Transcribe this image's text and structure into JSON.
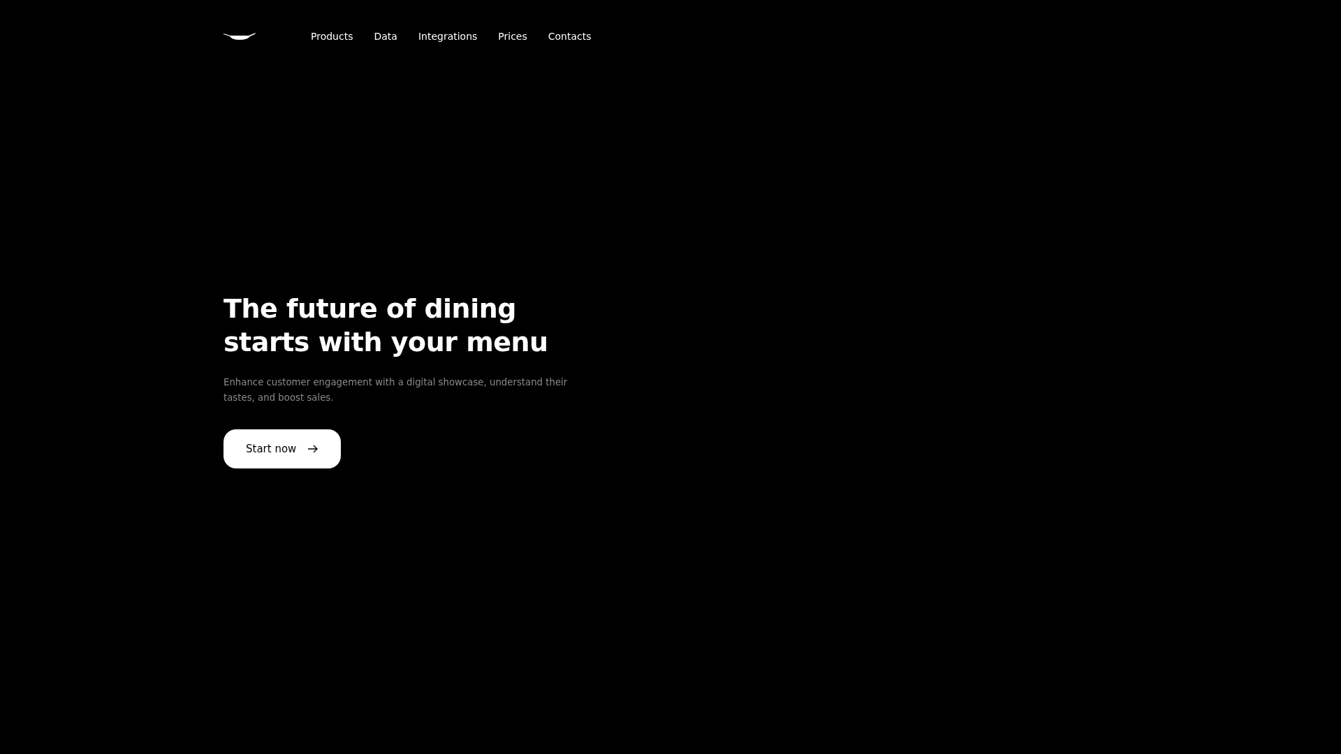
{
  "nav": {
    "items": [
      "Products",
      "Data",
      "Integrations",
      "Prices",
      "Contacts"
    ]
  },
  "hero": {
    "title": "The future of dining starts with your menu",
    "subtitle": "Enhance customer engagement with a digital showcase, understand their tastes, and boost sales.",
    "button": "Start now"
  }
}
